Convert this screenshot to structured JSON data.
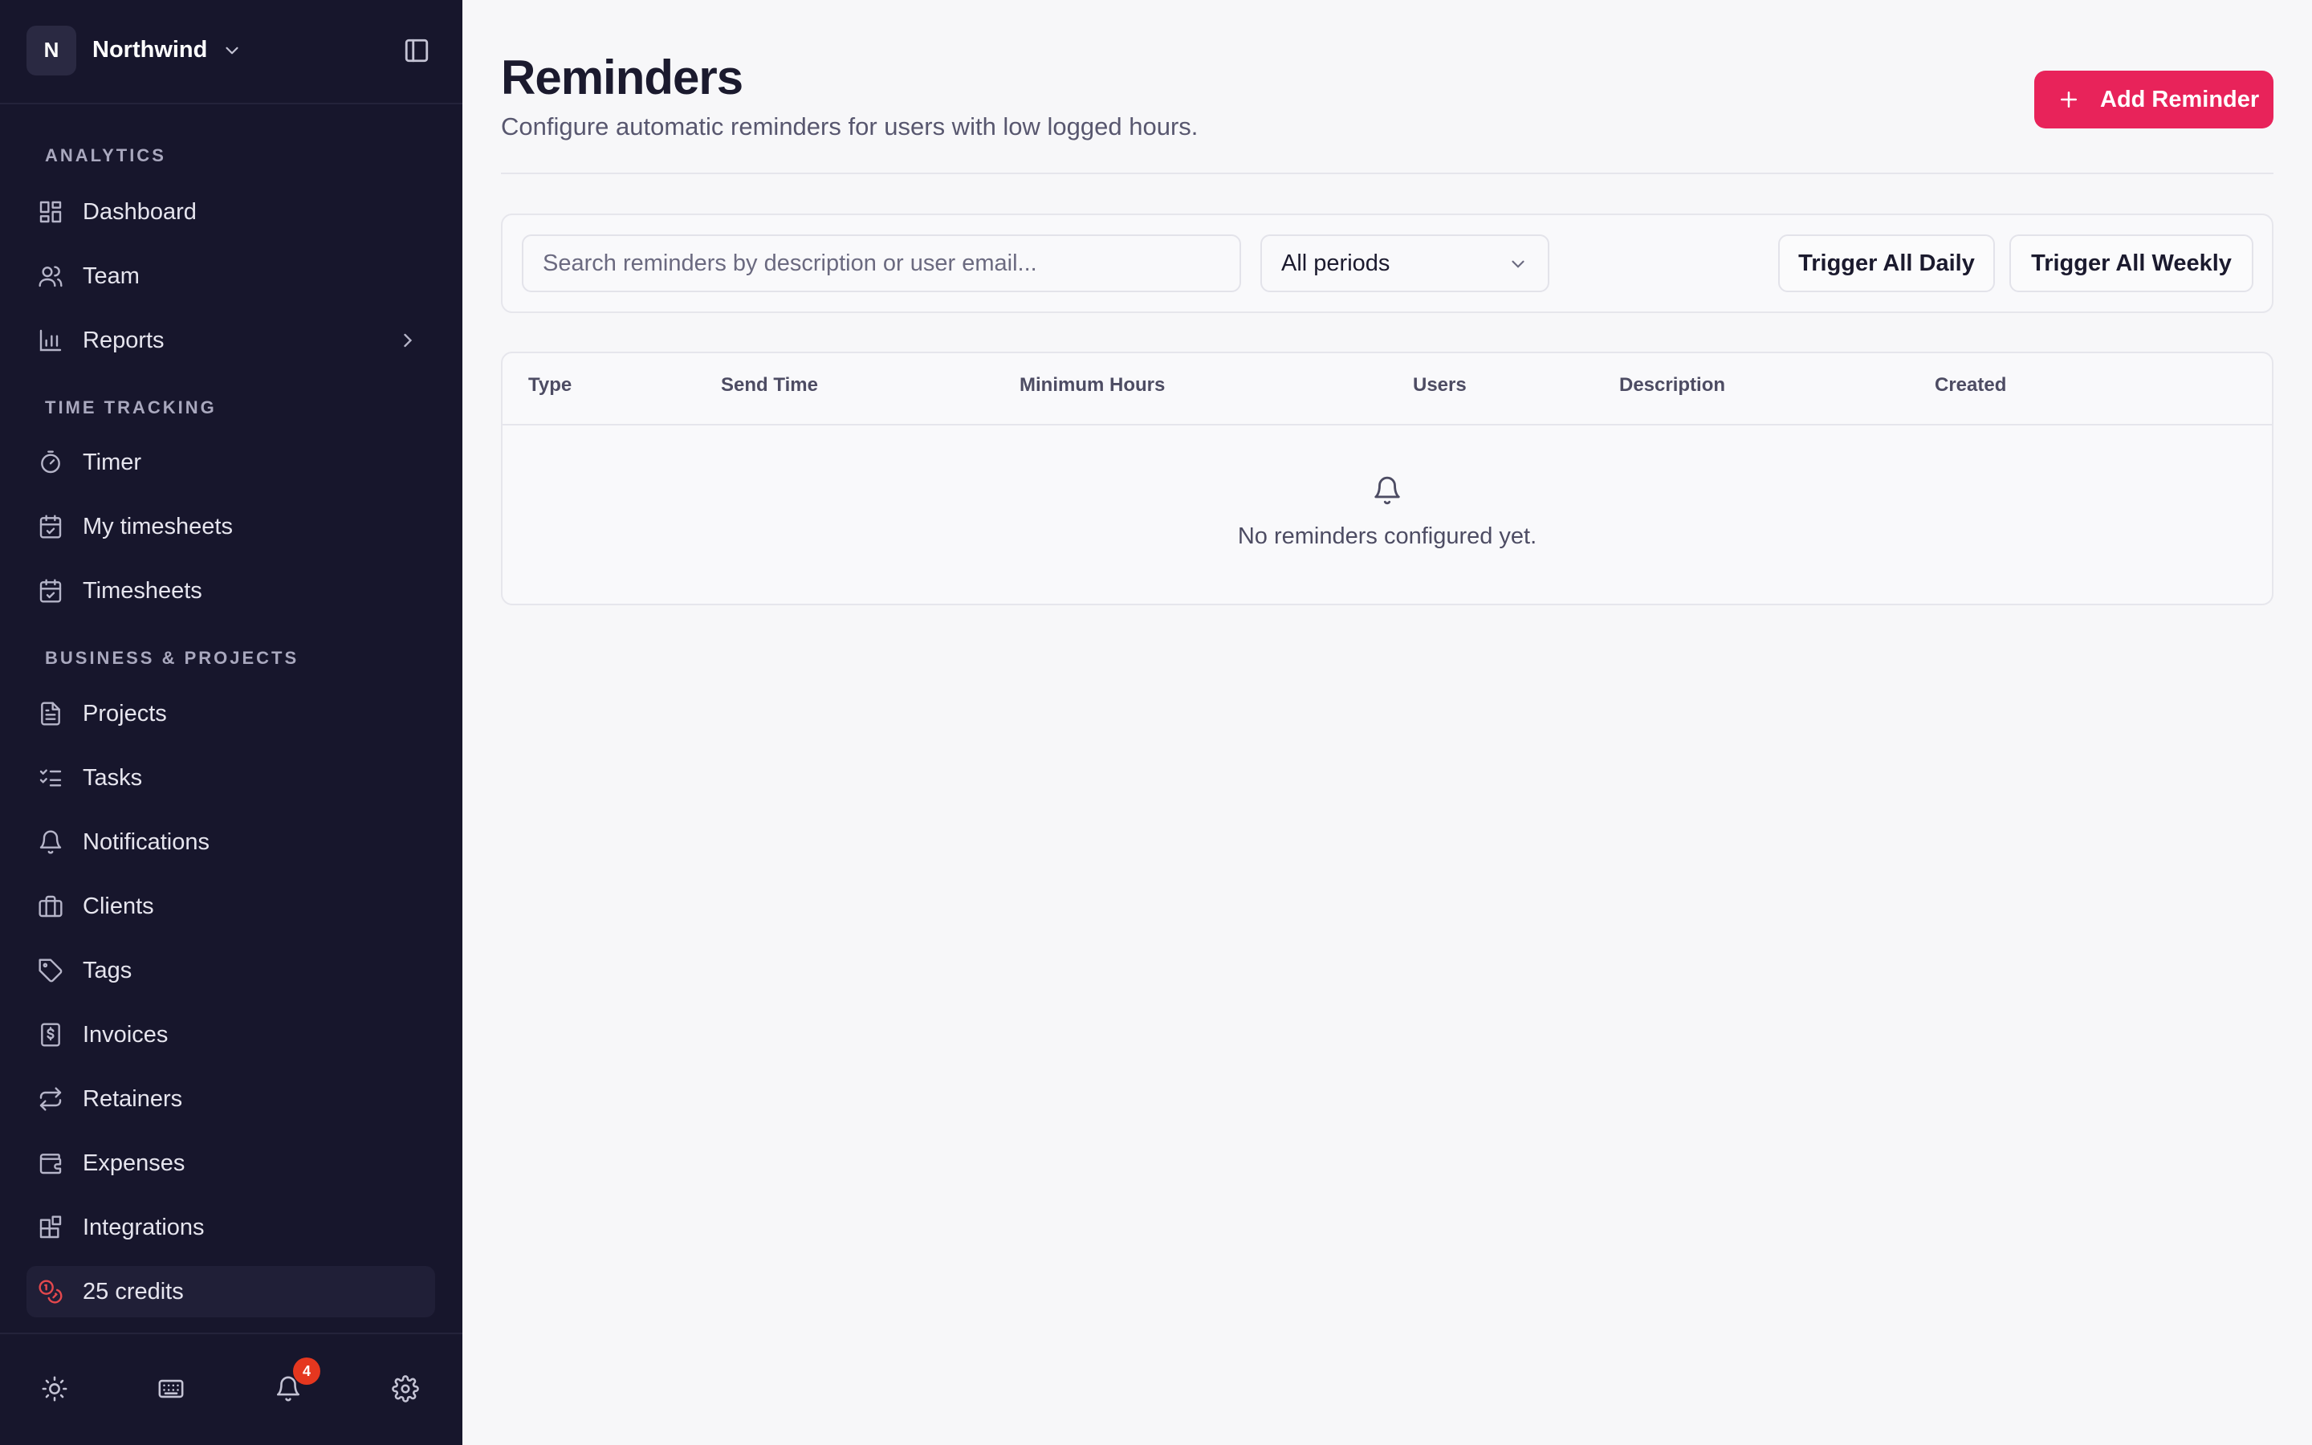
{
  "org": {
    "initial": "N",
    "name": "Northwind"
  },
  "sidebar": {
    "sections": {
      "analytics": "ANALYTICS",
      "time_tracking": "TIME TRACKING",
      "business": "BUSINESS & PROJECTS"
    },
    "items": {
      "dashboard": "Dashboard",
      "team": "Team",
      "reports": "Reports",
      "timer": "Timer",
      "my_timesheets": "My timesheets",
      "timesheets": "Timesheets",
      "projects": "Projects",
      "tasks": "Tasks",
      "notifications": "Notifications",
      "clients": "Clients",
      "tags": "Tags",
      "invoices": "Invoices",
      "retainers": "Retainers",
      "expenses": "Expenses",
      "integrations": "Integrations",
      "credits": "25 credits"
    },
    "notification_count": "4"
  },
  "page": {
    "title": "Reminders",
    "subtitle": "Configure automatic reminders for users with low logged hours.",
    "add_button": "Add Reminder"
  },
  "filters": {
    "search_placeholder": "Search reminders by description or user email...",
    "period_selected": "All periods",
    "trigger_daily": "Trigger All Daily",
    "trigger_weekly": "Trigger All Weekly"
  },
  "table": {
    "columns": [
      "Type",
      "Send Time",
      "Minimum Hours",
      "Users",
      "Description",
      "Created"
    ],
    "empty_message": "No reminders configured yet."
  },
  "colors": {
    "sidebar_bg": "#17162c",
    "accent": "#e8235a",
    "badge": "#e5371f",
    "page_bg": "#f7f7f9"
  }
}
